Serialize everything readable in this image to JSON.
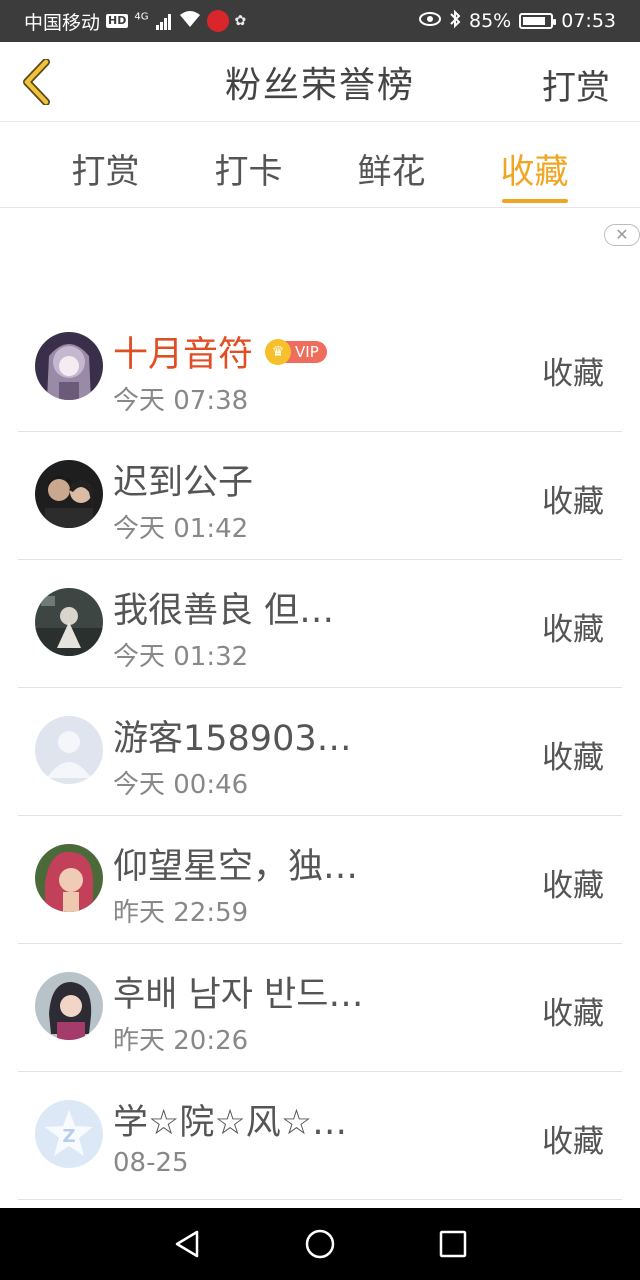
{
  "status_bar": {
    "carrier": "中国移动",
    "hd": "HD",
    "network": "4G",
    "battery_percent": "85%",
    "battery_level": 0.85,
    "time": "07:53"
  },
  "header": {
    "back_icon": "chevron-left-icon",
    "title": "粉丝荣誉榜",
    "action_label": "打赏"
  },
  "tabs": [
    {
      "label": "打赏",
      "active": false
    },
    {
      "label": "打卡",
      "active": false
    },
    {
      "label": "鲜花",
      "active": false
    },
    {
      "label": "收藏",
      "active": true
    }
  ],
  "ad_close_icon": "close-icon",
  "list": [
    {
      "name": "十月音符",
      "time": "今天 07:38",
      "action": "收藏",
      "vip": true,
      "vip_label": "VIP",
      "highlight": true,
      "avatar": "anime-girl-avatar"
    },
    {
      "name": "迟到公子",
      "time": "今天 01:42",
      "action": "收藏",
      "avatar": "couple-photo-avatar"
    },
    {
      "name": "我很善良 但…",
      "time": "今天 01:32",
      "action": "收藏",
      "avatar": "dark-photo-avatar"
    },
    {
      "name": "游客1589038…",
      "time": "今天 00:46",
      "action": "收藏",
      "avatar": "default-user-avatar"
    },
    {
      "name": "仰望星空，独…",
      "time": "昨天 22:59",
      "action": "收藏",
      "avatar": "red-hair-avatar"
    },
    {
      "name": "후배 남자 반드…",
      "time": "昨天 20:26",
      "action": "收藏",
      "avatar": "girl-photo-avatar"
    },
    {
      "name": "学☆院☆风☆…",
      "time": "08-25",
      "action": "收藏",
      "avatar": "qzone-logo-avatar"
    }
  ],
  "colors": {
    "accent": "#f0a623",
    "highlight_name": "#e04e23",
    "status_bar_bg": "#3c3c3c",
    "nav_bar_bg": "#000000"
  },
  "nav_bar": {
    "back": "triangle-back-icon",
    "home": "circle-home-icon",
    "recents": "square-recents-icon"
  }
}
